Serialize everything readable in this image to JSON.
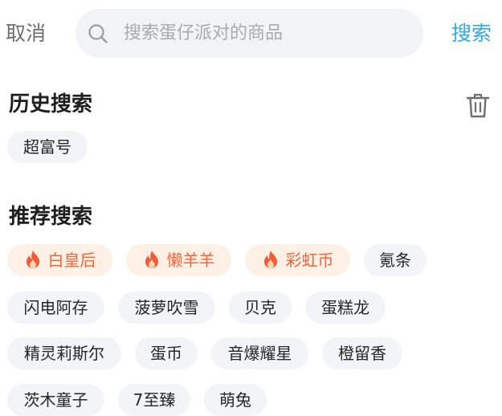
{
  "header": {
    "cancel_label": "取消",
    "search_placeholder": "搜索蛋仔派对的商品",
    "search_value": "",
    "search_button_label": "搜索",
    "search_icon": "search-icon"
  },
  "history": {
    "title": "历史搜索",
    "clear_icon": "trash-icon",
    "items": [
      "超富号"
    ]
  },
  "recommend": {
    "title": "推荐搜索",
    "hot_icon": "fire-icon",
    "items": [
      {
        "label": "白皇后",
        "hot": true
      },
      {
        "label": "懒羊羊",
        "hot": true
      },
      {
        "label": "彩虹币",
        "hot": true
      },
      {
        "label": "氪条",
        "hot": false
      },
      {
        "label": "闪电阿存",
        "hot": false
      },
      {
        "label": "菠萝吹雪",
        "hot": false
      },
      {
        "label": "贝克",
        "hot": false
      },
      {
        "label": "蛋糕龙",
        "hot": false
      },
      {
        "label": "精灵莉斯尔",
        "hot": false
      },
      {
        "label": "蛋币",
        "hot": false
      },
      {
        "label": "音爆耀星",
        "hot": false
      },
      {
        "label": "橙留香",
        "hot": false
      },
      {
        "label": "茨木童子",
        "hot": false
      },
      {
        "label": "7至臻",
        "hot": false
      },
      {
        "label": "萌兔",
        "hot": false
      }
    ]
  },
  "colors": {
    "accent": "#31a9ea",
    "hot_text": "#f2663b",
    "hot_bg": "#fdf1e6",
    "chip_bg": "#f3f4f8",
    "search_bg": "#f2f3f7"
  }
}
